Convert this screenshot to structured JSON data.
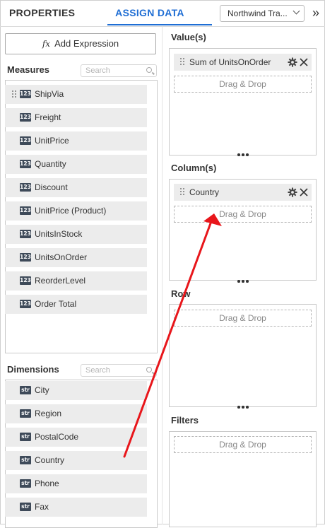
{
  "header": {
    "tabs": [
      {
        "label": "PROPERTIES",
        "active": false
      },
      {
        "label": "ASSIGN DATA",
        "active": true
      }
    ],
    "datasource_value": "Northwind Tra...",
    "expand_icon": "double-chevron-right-icon",
    "accent_color": "#1f6ed4"
  },
  "add_expression": {
    "icon": "fx",
    "label": "Add Expression"
  },
  "measures": {
    "title": "Measures",
    "search_placeholder": "Search",
    "badge": "123",
    "items": [
      "ShipVia",
      "Freight",
      "UnitPrice",
      "Quantity",
      "Discount",
      "UnitPrice (Product)",
      "UnitsInStock",
      "UnitsOnOrder",
      "ReorderLevel",
      "Order Total"
    ]
  },
  "dimensions": {
    "title": "Dimensions",
    "search_placeholder": "Search",
    "badge": "str",
    "items": [
      "City",
      "Region",
      "PostalCode",
      "Country",
      "Phone",
      "Fax"
    ]
  },
  "values": {
    "title": "Value(s)",
    "assigned": "Sum of UnitsOnOrder",
    "drop_text": "Drag & Drop"
  },
  "columns": {
    "title": "Column(s)",
    "assigned": "Country",
    "drop_text": "Drag & Drop"
  },
  "rows": {
    "title": "Row",
    "drop_text": "Drag & Drop"
  },
  "filters": {
    "title": "Filters",
    "drop_text": "Drag & Drop"
  },
  "annotation": {
    "color": "#e8161b",
    "meaning": "drag Country into Column(s)"
  }
}
